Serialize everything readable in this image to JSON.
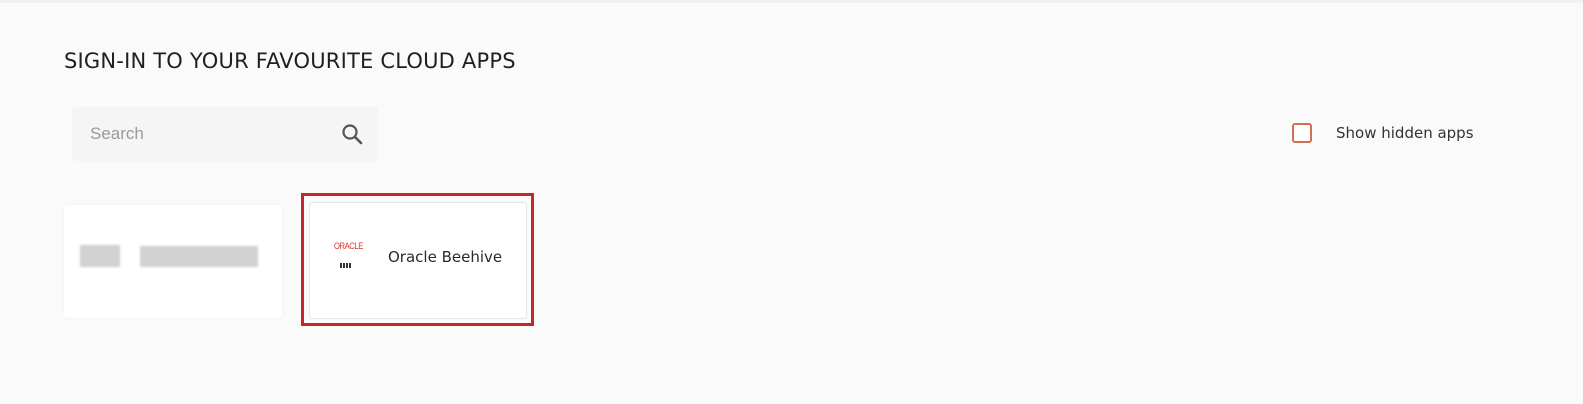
{
  "page": {
    "title": "SIGN-IN TO YOUR FAVOURITE CLOUD APPS"
  },
  "search": {
    "placeholder": "Search",
    "value": "",
    "icon": "search-icon"
  },
  "filters": {
    "show_hidden_label": "Show hidden apps",
    "show_hidden_checked": false,
    "checkbox_color": "#d0704f"
  },
  "apps": [
    {
      "name": "",
      "obscured": true
    },
    {
      "name": "Oracle Beehive",
      "logo_text": "ORACLE",
      "selected": true,
      "highlight_color": "#c8242b"
    }
  ]
}
